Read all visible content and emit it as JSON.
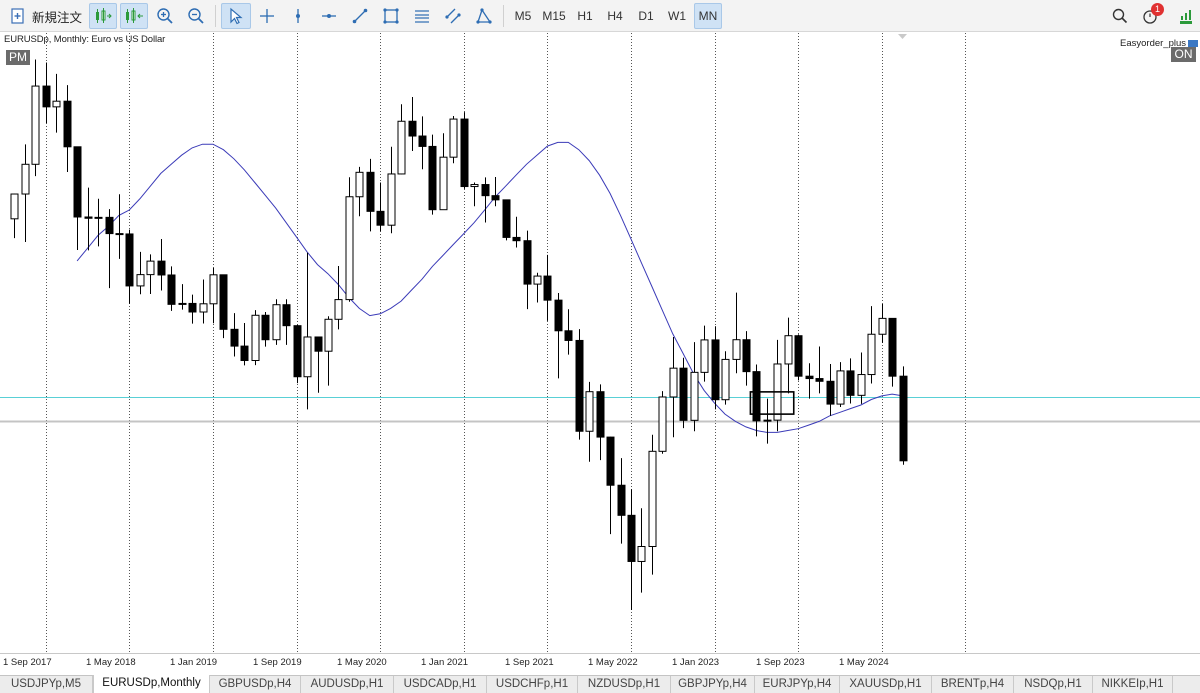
{
  "toolbar": {
    "new_order_label": "新規注文",
    "timeframes": [
      {
        "label": "M5",
        "active": false
      },
      {
        "label": "M15",
        "active": false
      },
      {
        "label": "H1",
        "active": false
      },
      {
        "label": "H4",
        "active": false
      },
      {
        "label": "D1",
        "active": false
      },
      {
        "label": "W1",
        "active": false
      },
      {
        "label": "MN",
        "active": true
      }
    ],
    "notification_count": "1",
    "tools": [
      "autoscroll-icon",
      "chart-shift-icon",
      "zoom-in-icon",
      "zoom-out-icon",
      "cursor-icon",
      "crosshair-icon",
      "vertical-line-icon",
      "horizontal-line-icon",
      "trendline-icon",
      "rectangle-icon",
      "fibonacci-icon",
      "channel-icon",
      "shapes-icon"
    ]
  },
  "chart": {
    "title": "EURUSDp, Monthly:  Euro vs US Dollar",
    "pm_label": "PM",
    "ea_name": "Easyorder_plus",
    "ea_status": "ON",
    "date_labels": [
      "1 Sep 2017",
      "1 May 2018",
      "1 Jan 2019",
      "1 Sep 2019",
      "1 May 2020",
      "1 Jan 2021",
      "1 Sep 2021",
      "1 May 2022",
      "1 Jan 2023",
      "1 Sep 2023",
      "1 May 2024"
    ]
  },
  "chart_data": {
    "type": "candlestick",
    "symbol": "EURUSDp",
    "timeframe": "Monthly",
    "colors": {
      "bull": "#ffffff",
      "bear": "#000000",
      "outline": "#000000",
      "ma": "#3b3bb8",
      "level_cyan": "#59d0d6",
      "level_gray": "#c4c4c4"
    },
    "candles": [
      [
        1.1681,
        1.1819,
        1.1575,
        1.1817
      ],
      [
        1.1817,
        1.2089,
        1.1554,
        1.198
      ],
      [
        1.198,
        1.2555,
        1.1915,
        1.2409
      ],
      [
        1.2409,
        1.2538,
        1.2206,
        1.2295
      ],
      [
        1.2295,
        1.2476,
        1.2154,
        1.2326
      ],
      [
        1.2326,
        1.2414,
        1.1938,
        1.2076
      ],
      [
        1.2076,
        1.1996,
        1.151,
        1.1691
      ],
      [
        1.1691,
        1.1852,
        1.1508,
        1.1684
      ],
      [
        1.1684,
        1.1791,
        1.153,
        1.1689
      ],
      [
        1.1689,
        1.1734,
        1.1301,
        1.16
      ],
      [
        1.16,
        1.1816,
        1.1461,
        1.1598
      ],
      [
        1.1598,
        1.1622,
        1.1215,
        1.1313
      ],
      [
        1.1313,
        1.15,
        1.1267,
        1.1375
      ],
      [
        1.1375,
        1.1486,
        1.1269,
        1.1449
      ],
      [
        1.1449,
        1.157,
        1.1288,
        1.1373
      ],
      [
        1.1373,
        1.142,
        1.1176,
        1.1212
      ],
      [
        1.1212,
        1.1323,
        1.1183,
        1.1217
      ],
      [
        1.1217,
        1.1265,
        1.1106,
        1.117
      ],
      [
        1.117,
        1.1348,
        1.1107,
        1.1215
      ],
      [
        1.1215,
        1.1412,
        1.1108,
        1.1374
      ],
      [
        1.1374,
        1.133,
        1.1027,
        1.1075
      ],
      [
        1.1075,
        1.1164,
        1.0926,
        1.0983
      ],
      [
        1.0983,
        1.111,
        1.0877,
        1.0904
      ],
      [
        1.0904,
        1.118,
        1.0879,
        1.1152
      ],
      [
        1.1152,
        1.117,
        1.098,
        1.1018
      ],
      [
        1.1018,
        1.124,
        1.099,
        1.121
      ],
      [
        1.121,
        1.124,
        1.099,
        1.1095
      ],
      [
        1.1095,
        1.11,
        1.078,
        1.0815
      ],
      [
        1.0815,
        1.1495,
        1.0636,
        1.1033
      ],
      [
        1.1033,
        1.1,
        1.0727,
        1.0955
      ],
      [
        1.0955,
        1.1147,
        1.0766,
        1.113
      ],
      [
        1.113,
        1.1422,
        1.1075,
        1.1238
      ],
      [
        1.1238,
        1.1909,
        1.1226,
        1.1802
      ],
      [
        1.1802,
        1.1966,
        1.1695,
        1.1936
      ],
      [
        1.1936,
        1.201,
        1.1612,
        1.1722
      ],
      [
        1.1722,
        1.188,
        1.1613,
        1.1646
      ],
      [
        1.1646,
        1.2076,
        1.1602,
        1.1927
      ],
      [
        1.1927,
        1.2309,
        1.1925,
        1.2216
      ],
      [
        1.2216,
        1.2349,
        1.2053,
        1.2135
      ],
      [
        1.2135,
        1.2243,
        1.1953,
        1.2078
      ],
      [
        1.2078,
        1.2143,
        1.1704,
        1.1731
      ],
      [
        1.1731,
        1.215,
        1.1731,
        1.2019
      ],
      [
        1.2019,
        1.2245,
        1.1986,
        1.2228
      ],
      [
        1.2228,
        1.2266,
        1.1845,
        1.1858
      ],
      [
        1.1858,
        1.188,
        1.175,
        1.1869
      ],
      [
        1.1869,
        1.1908,
        1.1661,
        1.1808
      ],
      [
        1.1808,
        1.191,
        1.175,
        1.1785
      ],
      [
        1.1785,
        1.165,
        1.1563,
        1.1579
      ],
      [
        1.1579,
        1.1692,
        1.1524,
        1.1561
      ],
      [
        1.1561,
        1.1616,
        1.1186,
        1.1323
      ],
      [
        1.1323,
        1.1385,
        1.1222,
        1.1367
      ],
      [
        1.1367,
        1.1483,
        1.1121,
        1.1235
      ],
      [
        1.1235,
        1.1274,
        1.0806,
        1.1067
      ],
      [
        1.1067,
        1.1185,
        1.0936,
        1.1014
      ],
      [
        1.1014,
        1.1076,
        1.047,
        1.0516
      ],
      [
        1.0516,
        1.0787,
        1.0349,
        1.0733
      ],
      [
        1.0733,
        1.0773,
        1.0358,
        1.0484
      ],
      [
        1.0484,
        1.0486,
        0.9952,
        1.022
      ],
      [
        1.022,
        1.0369,
        0.99,
        1.0055
      ],
      [
        1.0055,
        1.0198,
        0.9536,
        0.9802
      ],
      [
        0.9802,
        1.0094,
        0.9631,
        0.9884
      ],
      [
        0.9884,
        1.0497,
        0.973,
        1.0406
      ],
      [
        1.0406,
        1.0736,
        1.0393,
        1.0704
      ],
      [
        1.0704,
        1.1033,
        1.0483,
        1.0862
      ],
      [
        1.0862,
        1.0919,
        1.0533,
        1.0576
      ],
      [
        1.0576,
        1.1005,
        1.0516,
        1.0839
      ],
      [
        1.0839,
        1.1095,
        1.0788,
        1.1017
      ],
      [
        1.1017,
        1.1092,
        1.0636,
        1.0689
      ],
      [
        1.0689,
        1.0955,
        1.0662,
        1.091
      ],
      [
        1.091,
        1.1276,
        1.0834,
        1.1018
      ],
      [
        1.1018,
        1.1065,
        1.0766,
        1.0843
      ],
      [
        1.0843,
        1.0882,
        1.0488,
        1.0573
      ],
      [
        1.0573,
        1.0695,
        1.0448,
        1.0577
      ],
      [
        1.0577,
        1.1017,
        1.0516,
        1.0885
      ],
      [
        1.0885,
        1.1139,
        1.0724,
        1.104
      ],
      [
        1.104,
        1.1047,
        1.0795,
        1.0818
      ],
      [
        1.0818,
        1.0889,
        1.0695,
        1.0805
      ],
      [
        1.0805,
        1.0981,
        1.0724,
        1.079
      ],
      [
        1.079,
        1.0885,
        1.0601,
        1.0665
      ],
      [
        1.0665,
        1.0895,
        1.0649,
        1.0847
      ],
      [
        1.0847,
        1.0916,
        1.0668,
        1.0713
      ],
      [
        1.0713,
        1.0948,
        1.0666,
        1.0827
      ],
      [
        1.0827,
        1.1202,
        1.0778,
        1.1048
      ],
      [
        1.1048,
        1.1214,
        1.1001,
        1.1135
      ],
      [
        1.1135,
        1.1137,
        1.0761,
        1.0818
      ],
      [
        1.0818,
        1.0872,
        1.0332,
        1.0354
      ]
    ],
    "moving_average": {
      "start_index": 5,
      "values": [
        1.145,
        1.152,
        1.159,
        1.164,
        1.17,
        1.173,
        1.179,
        1.186,
        1.193,
        1.198,
        1.203,
        1.207,
        1.209,
        1.209,
        1.206,
        1.201,
        1.195,
        1.188,
        1.181,
        1.174,
        1.166,
        1.158,
        1.15,
        1.143,
        1.138,
        1.132,
        1.125,
        1.119,
        1.115,
        1.116,
        1.119,
        1.123,
        1.129,
        1.135,
        1.142,
        1.148,
        1.154,
        1.16,
        1.166,
        1.173,
        1.18,
        1.186,
        1.192,
        1.198,
        1.203,
        1.208,
        1.21,
        1.21,
        1.206,
        1.2,
        1.192,
        1.182,
        1.17,
        1.157,
        1.144,
        1.131,
        1.118,
        1.105,
        1.094,
        1.083,
        1.074,
        1.067,
        1.061,
        1.057,
        1.054,
        1.052,
        1.051,
        1.051,
        1.052,
        1.053,
        1.055,
        1.057,
        1.06,
        1.062,
        1.064,
        1.066,
        1.069,
        1.071,
        1.072,
        1.071
      ]
    },
    "horizontal_levels": [
      1.0705,
      1.057
    ],
    "marked_rectangle": {
      "from_index": 71,
      "to_index": 74,
      "top": 1.0732,
      "bottom": 1.061
    }
  },
  "tabs": [
    {
      "label": "USDJPYp,M5",
      "active": false
    },
    {
      "label": "EURUSDp,Monthly",
      "active": true
    },
    {
      "label": "GBPUSDp,H4",
      "active": false
    },
    {
      "label": "AUDUSDp,H1",
      "active": false
    },
    {
      "label": "USDCADp,H1",
      "active": false
    },
    {
      "label": "USDCHFp,H1",
      "active": false
    },
    {
      "label": "NZDUSDp,H1",
      "active": false
    },
    {
      "label": "GBPJPYp,H4",
      "active": false
    },
    {
      "label": "EURJPYp,H4",
      "active": false
    },
    {
      "label": "XAUUSDp,H1",
      "active": false
    },
    {
      "label": "BRENTp,H4",
      "active": false
    },
    {
      "label": "NSDQp,H1",
      "active": false
    },
    {
      "label": "NIKKEIp,H1",
      "active": false
    }
  ]
}
